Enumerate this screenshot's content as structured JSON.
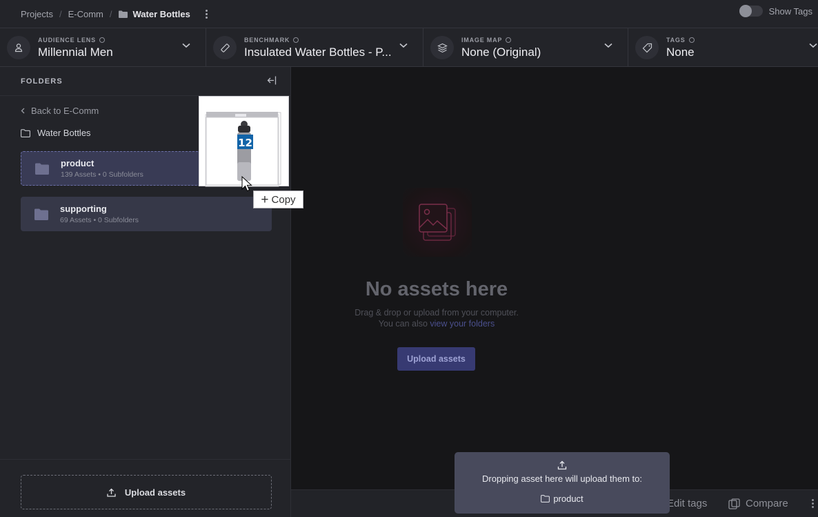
{
  "breadcrumb": {
    "items": [
      "Projects",
      "E-Comm"
    ],
    "current": "Water Bottles"
  },
  "header": {
    "show_tags_label": "Show Tags"
  },
  "selectors": [
    {
      "label": "AUDIENCE LENS",
      "value": "Millennial Men",
      "icon": "person-icon"
    },
    {
      "label": "BENCHMARK",
      "value": "Insulated Water Bottles - P...",
      "icon": "ruler-icon"
    },
    {
      "label": "IMAGE MAP",
      "value": "None (Original)",
      "icon": "layers-icon"
    },
    {
      "label": "TAGS",
      "value": "None",
      "icon": "tag-icon"
    }
  ],
  "sidebar": {
    "title": "FOLDERS",
    "back_label": "Back to E-Comm",
    "current_folder": "Water Bottles",
    "folders": [
      {
        "name": "product",
        "meta": "139 Assets • 0 Subfolders"
      },
      {
        "name": "supporting",
        "meta": "69 Assets • 0 Subfolders"
      }
    ],
    "upload_label": "Upload assets"
  },
  "main": {
    "empty_title": "No assets here",
    "empty_line1": "Drag & drop or upload from your computer.",
    "empty_line2": "You can also ",
    "empty_link": "view your folders",
    "upload_button": "Upload assets"
  },
  "bottombar": {
    "edit_tags": "Edit tags",
    "compare": "Compare"
  },
  "drop_toast": {
    "message": "Dropping asset here will upload them to:",
    "destination": "product"
  },
  "drag": {
    "badge": "12",
    "copy_label": "Copy"
  },
  "colors": {
    "accent": "#373a72",
    "link": "#4a4f8c",
    "sidebar_bg": "#232429",
    "main_bg": "#161618"
  }
}
